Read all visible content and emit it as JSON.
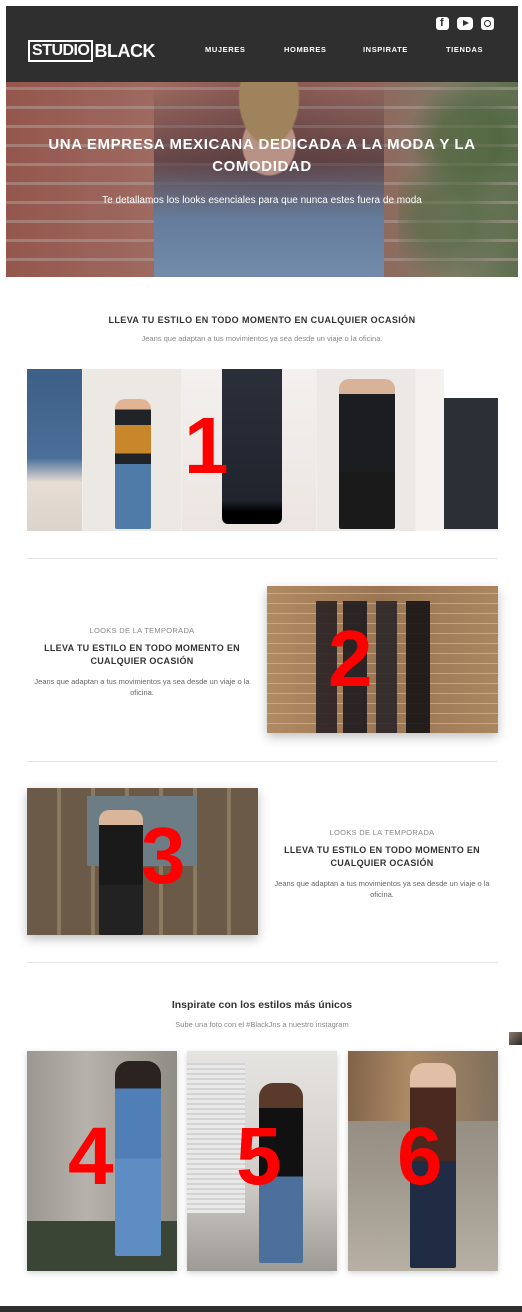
{
  "header": {
    "logo_studio": "STUDIO",
    "logo_black": "BLACK",
    "nav": [
      "MUJERES",
      "HOMBRES",
      "INSPIRATE",
      "TIENDAS"
    ],
    "social_icons": [
      "facebook-icon",
      "youtube-icon",
      "instagram-icon"
    ]
  },
  "hero": {
    "title": "UNA EMPRESA MEXICANA DEDICADA A LA MODA Y LA COMODIDAD",
    "subtitle": "Te detallamos los looks esenciales para que  nunca estes fuera de moda"
  },
  "section1": {
    "title": "LLEVA TU ESTILO EN TODO MOMENTO EN CUALQUIER OCASIÓN",
    "subtitle": "Jeans que adaptan a tus movimientos ya sea desde un viaje o la oficina.",
    "marker": "1"
  },
  "feature2": {
    "kicker": "LOOKS DE LA TEMPORADA",
    "title": "LLEVA TU ESTILO EN TODO MOMENTO EN CUALQUIER OCASIÓN",
    "desc": "Jeans que adaptan a tus movimientos ya sea desde un viaje o la oficina.",
    "marker": "2"
  },
  "feature3": {
    "kicker": "LOOKS DE LA TEMPORADA",
    "title": "LLEVA TU ESTILO EN TODO MOMENTO EN CUALQUIER OCASIÓN",
    "desc": "Jeans que adaptan a tus movimientos ya sea desde un viaje o la oficina.",
    "marker": "3"
  },
  "inspirate": {
    "title": "Inspirate con los estilos más únicos",
    "subtitle": "Sube una foto con el #BlackJns a nuestro instagram",
    "cards": [
      {
        "marker": "4"
      },
      {
        "marker": "5"
      },
      {
        "marker": "6"
      }
    ]
  },
  "colors": {
    "header_bg": "#2f2f2f",
    "marker_red": "#ff0000"
  }
}
